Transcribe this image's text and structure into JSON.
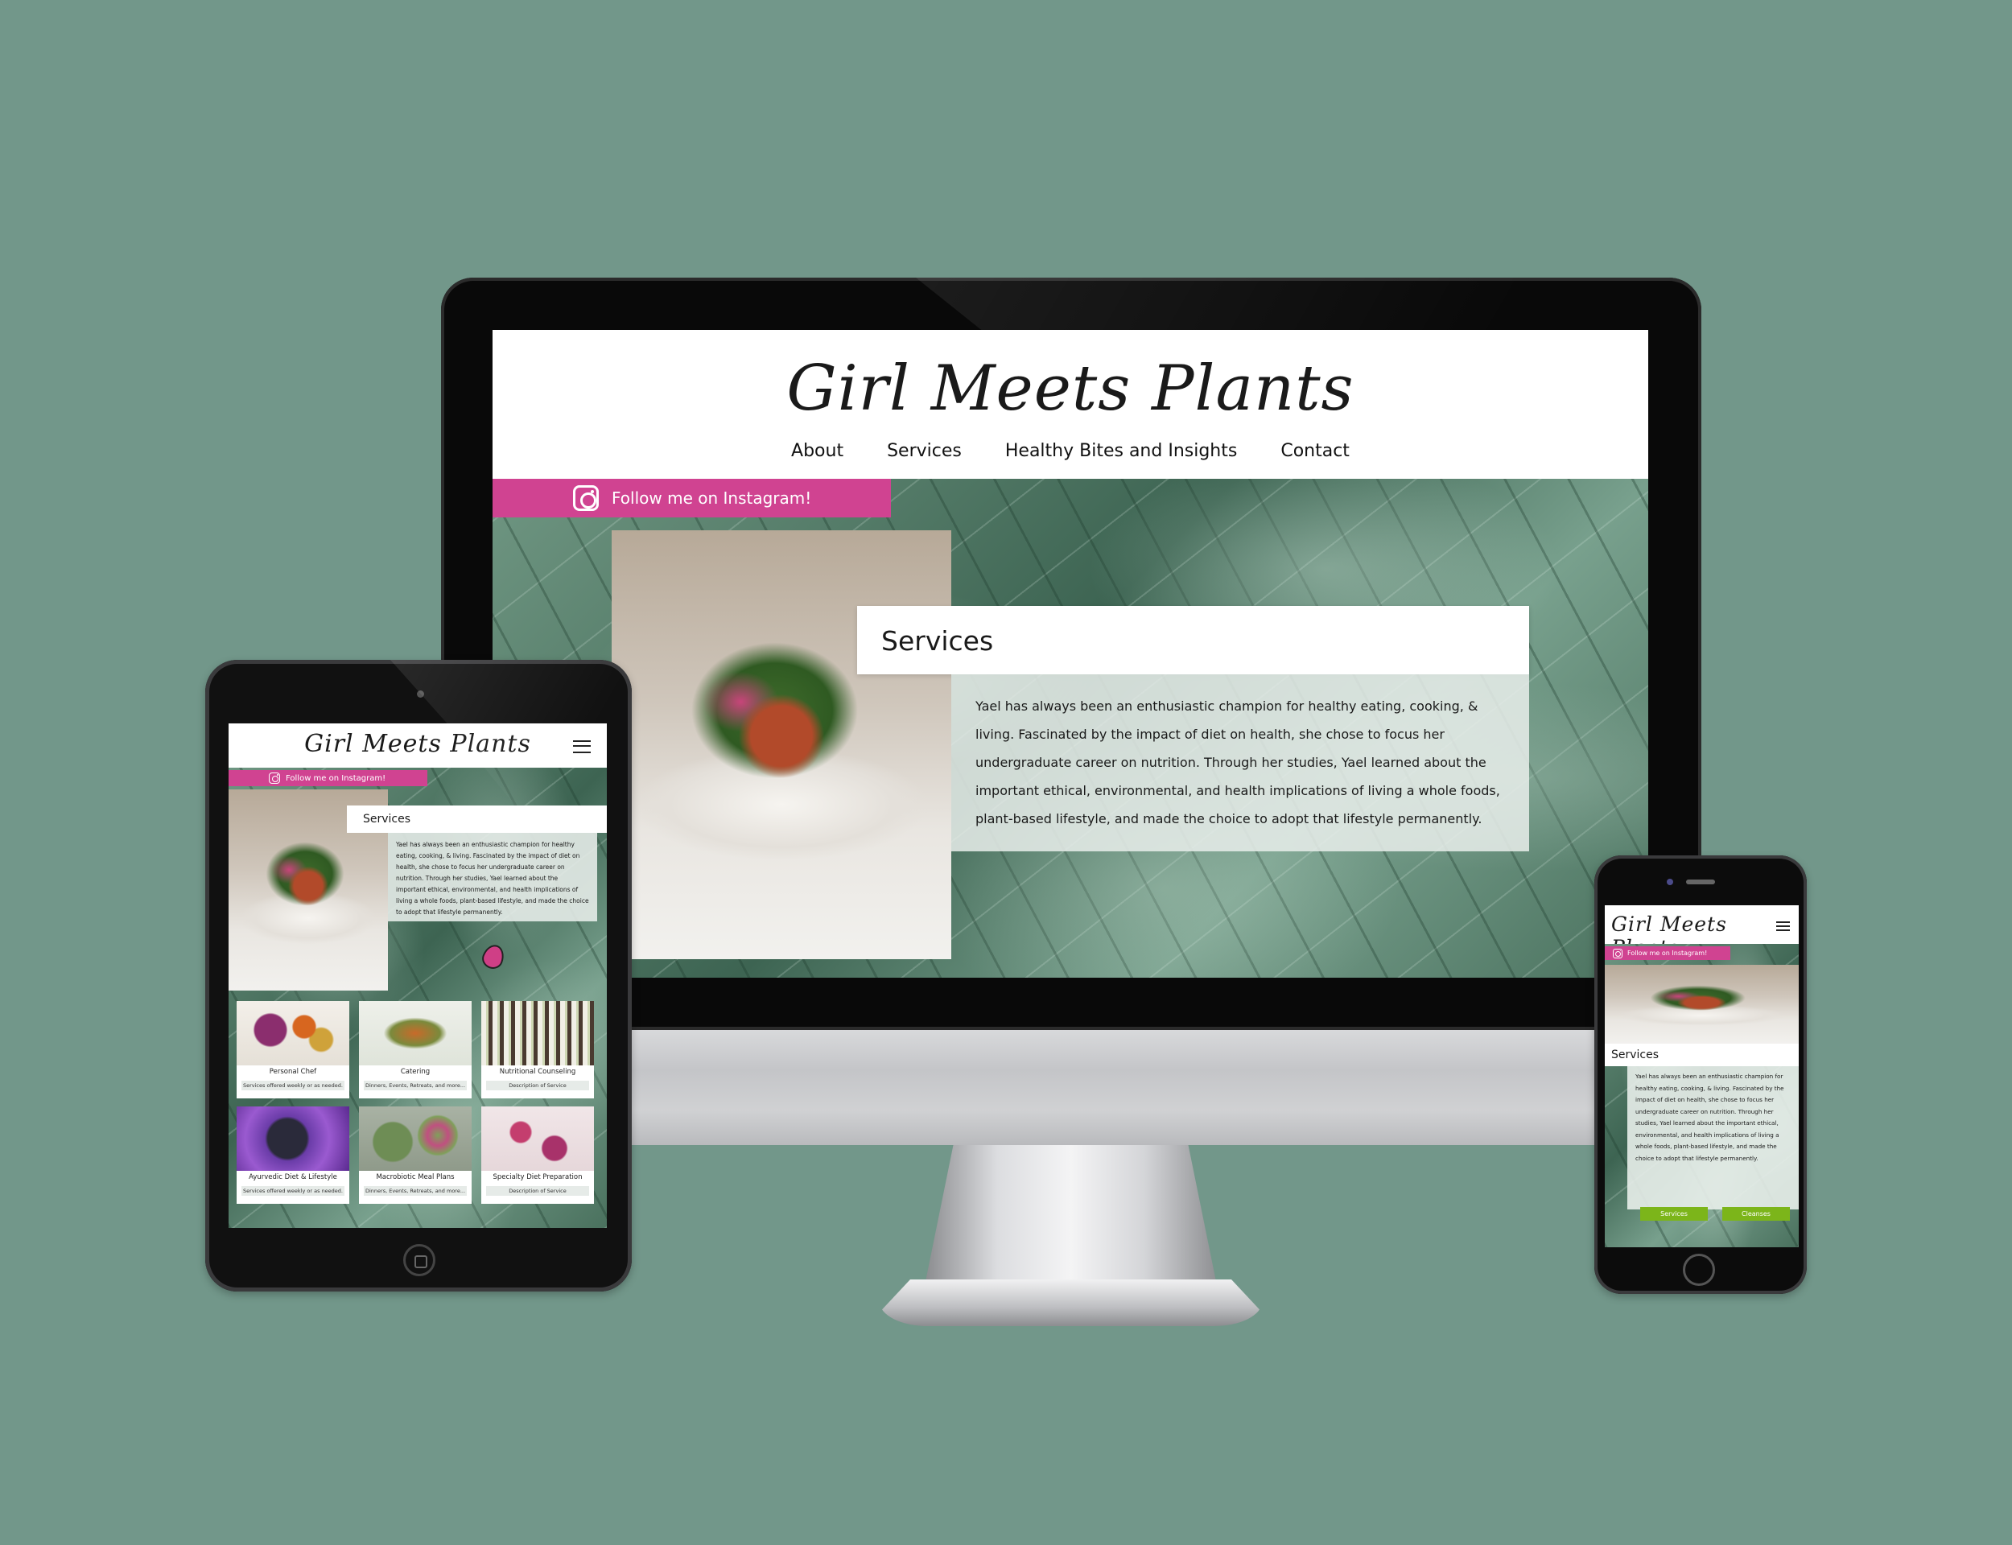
{
  "brand": {
    "name": "Girl Meets Plants",
    "colors": {
      "accent_pink": "#d04391",
      "accent_green": "#7cb51a",
      "backdrop": "#72978a"
    }
  },
  "nav": {
    "items": [
      "About",
      "Services",
      "Healthy Bites and Insights",
      "Contact"
    ]
  },
  "instagram": {
    "label": "Follow me on Instagram!",
    "icon": "instagram-icon"
  },
  "services": {
    "title": "Services",
    "description": "Yael has always been an enthusiastic champion for healthy eating, cooking, & living. Fascinated by the impact of diet on health, she chose to focus her undergraduate career on nutrition. Through her studies, Yael learned about the important ethical, environmental, and health implications of living a whole foods, plant-based lifestyle, and made the choice to adopt that lifestyle permanently."
  },
  "service_cards": [
    {
      "title": "Personal Chef",
      "description": "Services offered weekly or as needed."
    },
    {
      "title": "Catering",
      "description": "Dinners, Events, Retreats, and more..."
    },
    {
      "title": "Nutritional Counseling",
      "description": "Description of Service"
    },
    {
      "title": "Ayurvedic Diet & Lifestyle",
      "description": "Services offered weekly or as needed."
    },
    {
      "title": "Macrobiotic Meal Plans",
      "description": "Dinners, Events, Retreats, and more..."
    },
    {
      "title": "Specialty Diet Preparation",
      "description": "Description of Service"
    }
  ],
  "mobile_buttons": {
    "services": "Services",
    "cleanses": "Cleanses"
  },
  "icons": {
    "menu": "hamburger-menu-icon",
    "logo_mark": "beet-icon"
  }
}
